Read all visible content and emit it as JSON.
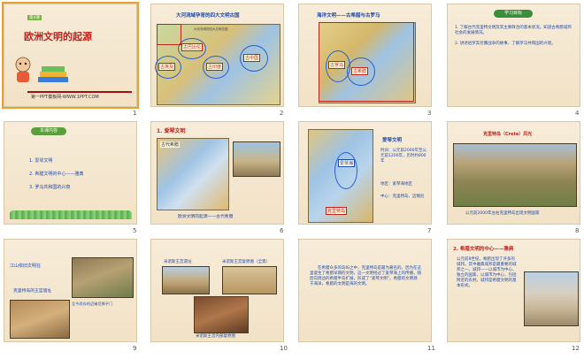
{
  "slides": [
    {
      "num": "1",
      "title": "欧洲文明的起源",
      "badge": "第4课",
      "footer": "第一PPT模板网-WWW.1PPT.COM"
    },
    {
      "num": "2",
      "title": "大河流域孕育的四大文明古国",
      "labels": [
        "古巴比伦",
        "古埃及",
        "古印度",
        "古中国"
      ],
      "legend": "大河流域的四大文明古国"
    },
    {
      "num": "3",
      "title": "海洋文明——古希腊与古罗马",
      "labels": [
        "古罗马",
        "古希腊"
      ]
    },
    {
      "num": "4",
      "badge": "学习目标",
      "items": [
        "1. 了解古代克里特文明及其主要政治的基本状况。知道古希腊城邦社会的发展情况。",
        "2. 讲述伯罗奔尼撒战争的故事，了解罗马共和国的兴衰。"
      ]
    },
    {
      "num": "5",
      "badge": "本课内容",
      "items": [
        "1. 爱琴文明",
        "2. 希腊文明的中心——雅典",
        "3. 罗马共和国的兴衰"
      ]
    },
    {
      "num": "6",
      "title": "1. 爱琴文明",
      "map_title": "古代希腊",
      "caption": "欧洲文明的起源——古代希腊"
    },
    {
      "num": "7",
      "title": "爱琴文明",
      "notes": [
        "时间：公元前2000年至公元前1200年，历时约800年",
        "地区：爱琴海地区",
        "中心：克里特岛、迈锡尼"
      ],
      "labels": [
        "爱琴海",
        "克里特岛"
      ]
    },
    {
      "num": "8",
      "title": "克里特岛（Crete）风光",
      "caption": "公元前2000年左右克里特岛出现文明国家"
    },
    {
      "num": "9",
      "title": "江山依旧文明在",
      "captions": [
        "克里特岛的王宫遗址",
        "至今尚存的迈锡尼狮子门"
      ]
    },
    {
      "num": "10",
      "captions": [
        "米诺斯王宫遗址",
        "米诺斯王宫复原图（全景）",
        "米诺斯王宫内部复原图"
      ]
    },
    {
      "num": "11",
      "body": "在希腊众多的岛屿之中，克里特岛是最为著名的。因为在这里诞生了希腊早期的文明，这一文明经过了爱琴海上的传播，随后向周边的希腊半岛扩展，形成了“爱琴文明”。希腊的文明源于海洋，希腊的文明是海的文明。"
    },
    {
      "num": "12",
      "title": "2. 希腊文明的中心——雅典",
      "body": "公元前8世纪，希腊出现了许多的城邦。其中雅典城邦是最重要的城邦之一。城邦——以城市为中心、独立的国家，以城市为中心，包括附近的农村。城邦是希腊文明的基本形式。"
    }
  ],
  "colors": {
    "accent": "#c0231e",
    "blue": "#1f4aa8",
    "bg": "#f7ecd9"
  }
}
